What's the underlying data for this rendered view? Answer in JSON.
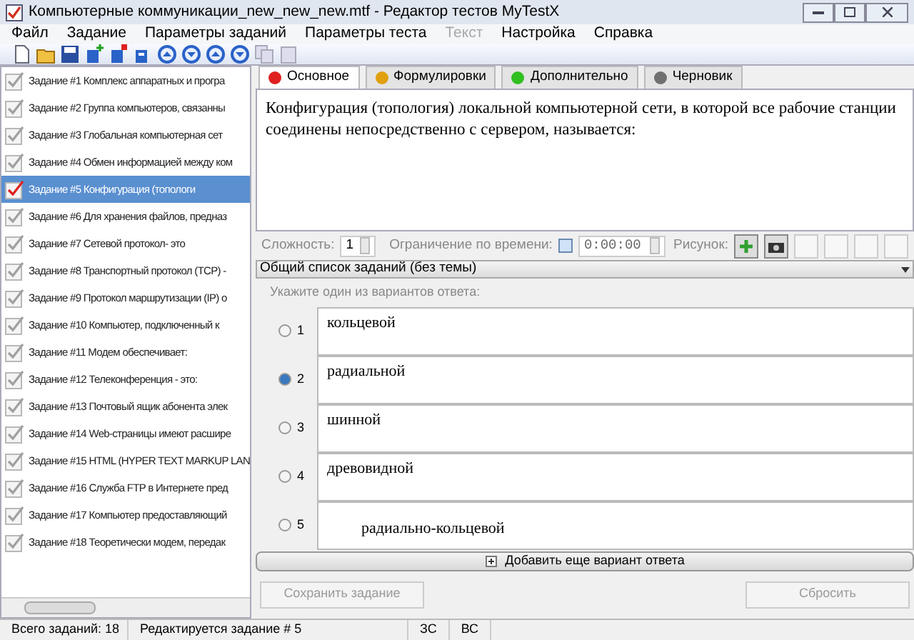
{
  "window": {
    "title": "Компьютерные коммуникации_new_new_new.mtf - Редактор тестов MyTestX"
  },
  "menu": [
    {
      "label": "Файл",
      "disabled": false
    },
    {
      "label": "Задание",
      "disabled": false
    },
    {
      "label": "Параметры заданий",
      "disabled": false
    },
    {
      "label": "Параметры теста",
      "disabled": false
    },
    {
      "label": "Текст",
      "disabled": true
    },
    {
      "label": "Настройка",
      "disabled": false
    },
    {
      "label": "Справка",
      "disabled": false
    }
  ],
  "tasks": [
    {
      "label": "Задание #1 Комплекс аппаратных и програ",
      "selected": false
    },
    {
      "label": "Задание #2 Группа компьютеров, связанны",
      "selected": false
    },
    {
      "label": "Задание #3 Глобальная компьютерная сет",
      "selected": false
    },
    {
      "label": "Задание #4 Обмен информацией между ком",
      "selected": false
    },
    {
      "label": "Задание #5 Конфигурация (топологи",
      "selected": true
    },
    {
      "label": "Задание #6 Для хранения файлов, предназ",
      "selected": false
    },
    {
      "label": "Задание #7 Сетевой протокол- это",
      "selected": false
    },
    {
      "label": "Задание #8 Транспортный протокол (TCP) -",
      "selected": false
    },
    {
      "label": "Задание #9 Протокол маршрутизации (IP) о",
      "selected": false
    },
    {
      "label": "Задание #10 Компьютер, подключенный к",
      "selected": false
    },
    {
      "label": "Задание #11 Модем обеспечивает:",
      "selected": false
    },
    {
      "label": "Задание #12 Телеконференция - это:",
      "selected": false
    },
    {
      "label": "Задание #13 Почтовый ящик абонента элек",
      "selected": false
    },
    {
      "label": "Задание #14 Web-страницы имеют расшире",
      "selected": false
    },
    {
      "label": "Задание #15 HTML (HYPER TEXT MARKUP LAN",
      "selected": false
    },
    {
      "label": "Задание #16 Служба FTP в Интернете пред",
      "selected": false
    },
    {
      "label": "Задание #17 Компьютер предоставляющий",
      "selected": false
    },
    {
      "label": "Задание #18 Теоретически модем, передак",
      "selected": false
    }
  ],
  "tabs": [
    {
      "label": "Основное",
      "selected": true,
      "color": "#e02020"
    },
    {
      "label": "Формулировки",
      "selected": false,
      "color": "#e0a010"
    },
    {
      "label": "Дополнительно",
      "selected": false,
      "color": "#30c020"
    },
    {
      "label": "Черновик",
      "selected": false,
      "color": "#707070"
    }
  ],
  "question": "Конфигурация (топология) локальной компьютерной сети, в которой все рабочие станции соединены непосредственно с сервером, называется:",
  "settings": {
    "difficulty_label": "Сложность:",
    "difficulty": "1",
    "time_label": "Ограничение по времени:",
    "time_limit_checked": false,
    "time": "0:00:00",
    "picture_label": "Рисунок:"
  },
  "topic_dropdown": "Общий список заданий (без темы)",
  "hint": "Укажите один из вариантов ответа:",
  "answers": [
    {
      "number": "1",
      "text": "кольцевой",
      "selected": false
    },
    {
      "number": "2",
      "text": "радиальной",
      "selected": true
    },
    {
      "number": "3",
      "text": "шинной",
      "selected": false
    },
    {
      "number": "4",
      "text": "древовидной",
      "selected": false
    },
    {
      "number": "5",
      "text": "радиально-кольцевой",
      "selected": false
    }
  ],
  "add_answer_button": "Добавить еще вариант ответа",
  "save_button": {
    "label": "Сохранить задание",
    "disabled": true
  },
  "reset_button": {
    "label": "Сбросить",
    "disabled": true
  },
  "status_bar": [
    "Всего заданий: 18",
    "Редактируется задание # 5",
    "ЗС",
    "ВС"
  ]
}
